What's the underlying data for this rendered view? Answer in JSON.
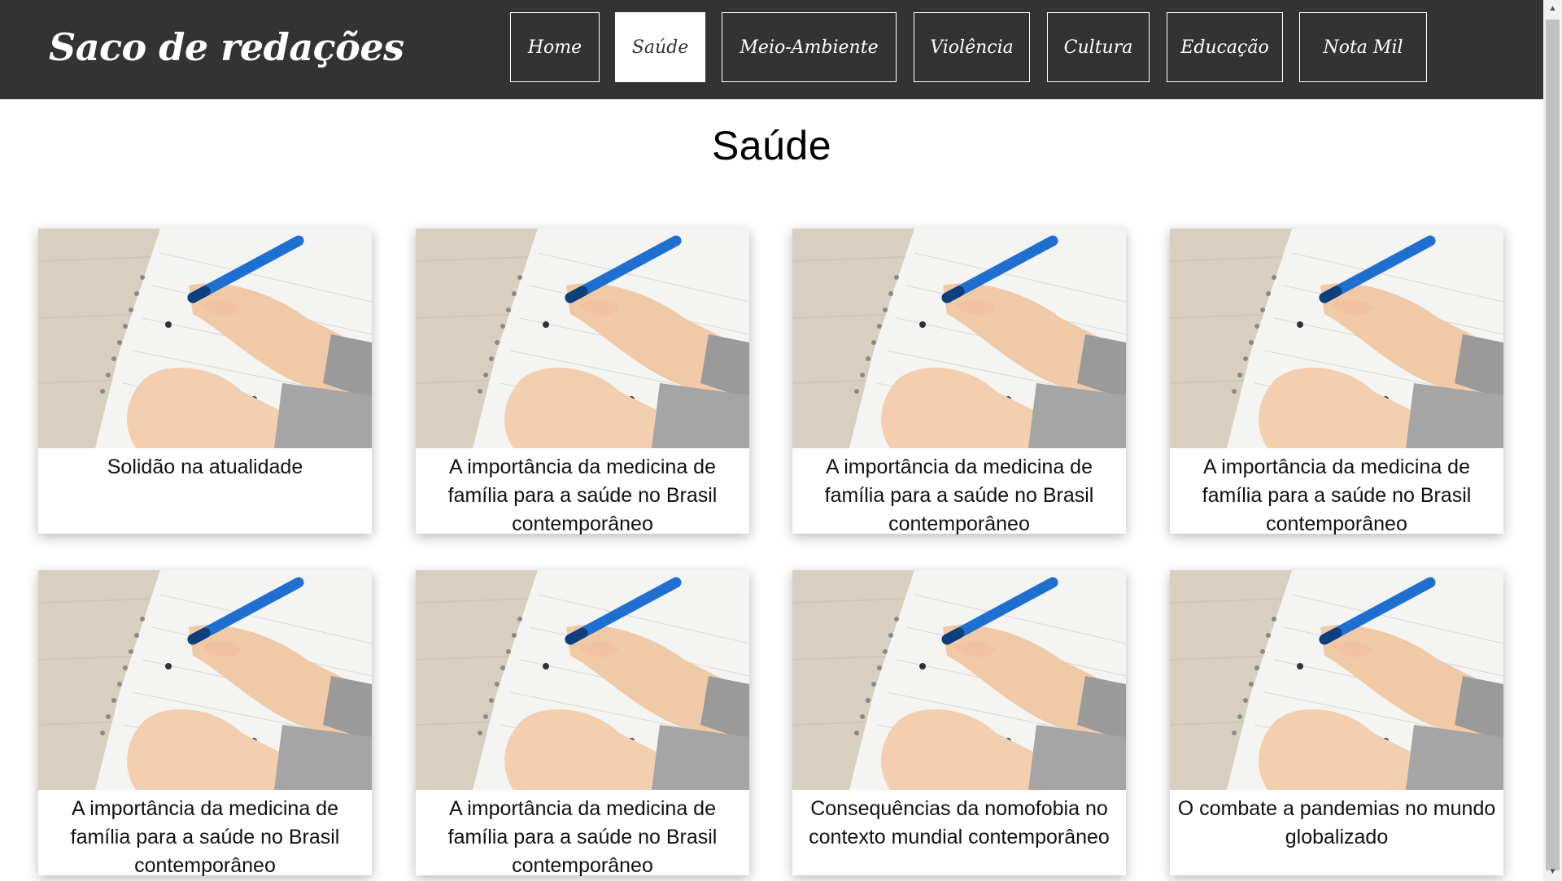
{
  "site": {
    "logo": "Saco de redações"
  },
  "nav": [
    {
      "label": "Home",
      "active": false
    },
    {
      "label": "Saúde",
      "active": true
    },
    {
      "label": "Meio-Ambiente",
      "active": false
    },
    {
      "label": "Violência",
      "active": false
    },
    {
      "label": "Cultura",
      "active": false
    },
    {
      "label": "Educação",
      "active": false
    },
    {
      "label": "Nota Mil",
      "active": false
    }
  ],
  "page": {
    "title": "Saúde"
  },
  "cards": [
    {
      "title": "Solidão na atualidade"
    },
    {
      "title": "A importância da medicina de família para a saúde no Brasil contemporâneo"
    },
    {
      "title": "A importância da medicina de família para a saúde no Brasil contemporâneo"
    },
    {
      "title": "A importância da medicina de família para a saúde no Brasil contemporâneo"
    },
    {
      "title": "A importância da medicina de família para a saúde no Brasil contemporâneo"
    },
    {
      "title": "A importância da medicina de família para a saúde no Brasil contemporâneo"
    },
    {
      "title": "Consequências da nomofobia no contexto mundial contemporâneo"
    },
    {
      "title": "O combate a pandemias no mundo globalizado"
    }
  ],
  "colors": {
    "header_bg": "#333333",
    "pen_blue": "#1f6fd1",
    "wood": "#d8cdbd"
  },
  "icons": {
    "card_image": "hand-writing-with-blue-pen-image"
  }
}
